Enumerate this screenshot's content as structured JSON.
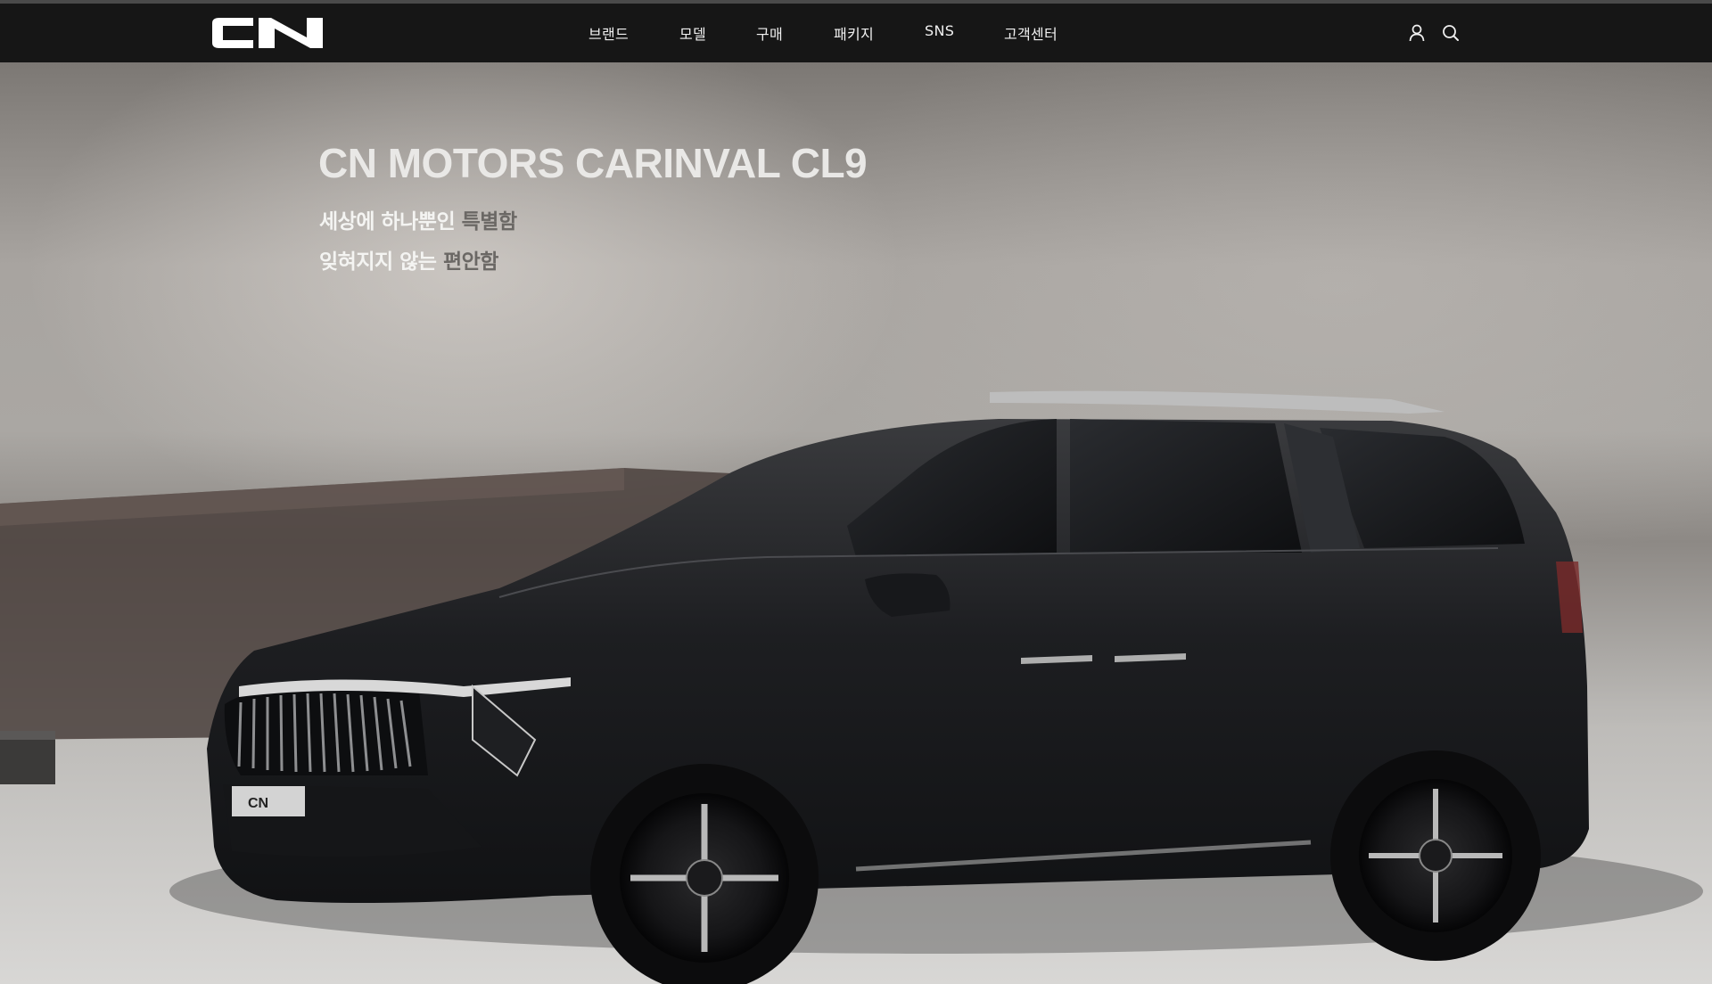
{
  "brand": {
    "logo_text": "CN"
  },
  "nav": {
    "items": [
      {
        "label": "브랜드"
      },
      {
        "label": "모델"
      },
      {
        "label": "구매"
      },
      {
        "label": "패키지"
      },
      {
        "label": "SNS"
      },
      {
        "label": "고객센터"
      }
    ],
    "icons": [
      "user-icon",
      "search-icon"
    ]
  },
  "hero": {
    "title": "CN MOTORS  CARINVAL CL9",
    "line1_plain": "세상에 하나뿐인 ",
    "line1_accent": "특별함",
    "line2_plain": "잊혀지지 않는 ",
    "line2_accent": "편안함",
    "car_badge": "CN"
  },
  "colors": {
    "nav_bg": "#161616",
    "nav_text": "#f0f0f0",
    "title_text": "#e9e8e6",
    "accent_text": "#6b6865"
  }
}
